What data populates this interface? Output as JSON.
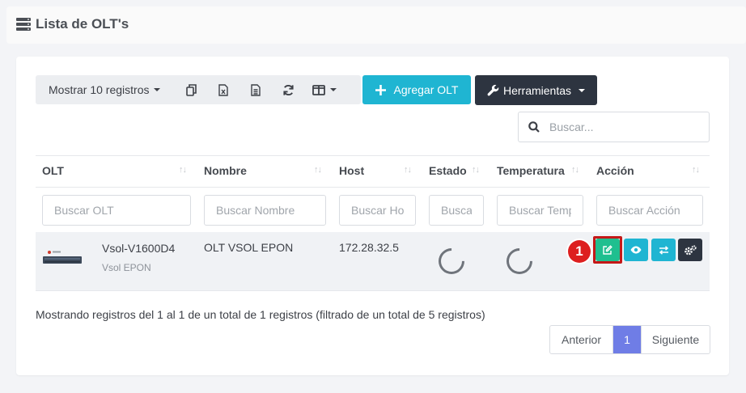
{
  "page": {
    "title": "Lista de OLT's"
  },
  "toolbar": {
    "length_label": "Mostrar 10 registros",
    "copy_icon": "copy-icon",
    "excel_icon": "file-excel-icon",
    "csv_icon": "file-text-icon",
    "refresh_icon": "refresh-icon",
    "columns_icon": "columns-icon",
    "add_label": "Agregar OLT",
    "tools_label": "Herramientas"
  },
  "search": {
    "placeholder": "Buscar..."
  },
  "table": {
    "columns": [
      "OLT",
      "Nombre",
      "Host",
      "Estado",
      "Temperatura",
      "Acción"
    ],
    "filters": [
      "Buscar OLT",
      "Buscar Nombre",
      "Buscar Host",
      "Buscar Estado",
      "Buscar Temperatura",
      "Buscar Acción"
    ],
    "rows": [
      {
        "model": "Vsol-V1600D4",
        "type": "Vsol EPON",
        "nombre": "OLT VSOL EPON",
        "host": "172.28.32.5",
        "estado": "loading",
        "temperatura": "loading",
        "actions": [
          "edit-icon",
          "eye-icon",
          "exchange-icon",
          "cogs-icon"
        ]
      }
    ]
  },
  "annotation": {
    "badge": "1"
  },
  "footer": {
    "info": "Mostrando registros del 1 al 1 de un total de 1 registros (filtrado de un total de 5 registros)",
    "prev": "Anterior",
    "current": "1",
    "next": "Siguiente"
  },
  "colors": {
    "add_button": "#1fb5d2",
    "tools_button": "#2d3440",
    "edit_button": "#1fbf8f",
    "view_button": "#1fb5d2",
    "pager_active": "#6f7de6",
    "badge": "#dd1f1f"
  }
}
